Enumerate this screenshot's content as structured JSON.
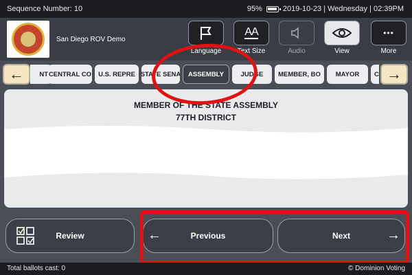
{
  "statusbar": {
    "sequence": "Sequence Number: 10",
    "battery": "95%",
    "datetime": "2019-10-23 | Wednesday | 02:39PM"
  },
  "header": {
    "org_name": "San Diego ROV Demo",
    "tools": [
      {
        "label": "Language",
        "icon": "flag-icon",
        "disabled": false
      },
      {
        "label": "Text Size",
        "icon": "text-size-icon",
        "glyph": "AA",
        "disabled": false
      },
      {
        "label": "Audio",
        "icon": "speaker-icon",
        "disabled": true
      },
      {
        "label": "View",
        "icon": "eye-icon",
        "disabled": false
      },
      {
        "label": "More",
        "icon": "more-icon",
        "glyph": "•••",
        "disabled": false
      }
    ]
  },
  "tabs": [
    {
      "label": "NT",
      "active": false
    },
    {
      "label": "CENTRAL CO",
      "active": false
    },
    {
      "label": "U.S. REPRE",
      "active": false
    },
    {
      "label": "STATE SENA",
      "active": false
    },
    {
      "label": "ASSEMBLY",
      "active": true
    },
    {
      "label": "JUDGE",
      "active": false
    },
    {
      "label": "MEMBER, BO",
      "active": false
    },
    {
      "label": "MAYOR",
      "active": false
    },
    {
      "label": "CI",
      "active": false
    }
  ],
  "contest": {
    "title_line1": "MEMBER OF THE STATE ASSEMBLY",
    "title_line2": "77TH DISTRICT"
  },
  "footer": {
    "review_label": "Review",
    "previous_label": "Previous",
    "next_label": "Next"
  },
  "bottombar": {
    "ballots": "Total ballots cast: 0",
    "vendor": "© Dominion Voting"
  },
  "colors": {
    "annotation": "#e01212",
    "tab_nav_bg": "#f5e6c2",
    "status_bar": "#1b1d22"
  }
}
